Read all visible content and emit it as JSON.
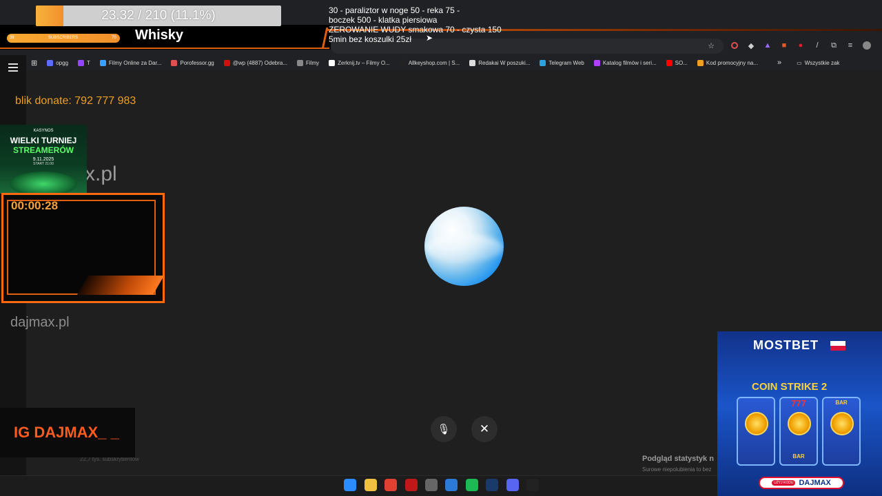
{
  "overlay": {
    "sub_goal_text": "23.32 / 210 (11.1%)",
    "sub_goal_progress": 0.111,
    "mini_left": "38",
    "mini_label": "SUBSCRIBERS",
    "mini_right": "70",
    "stream_title": "Whisky",
    "goals": [
      "30 - paraliztor w noge 50 - reka 75 -",
      " boczek 500 - klatka piersiowa",
      "ZEROWANIE WUDY smakowa 70 - czysta 150",
      "5min bez koszulki 25zł"
    ],
    "blik": "blik donate: 792 777 983",
    "kasyno_brand": "KASYNOS",
    "kasyno_title1": "WIELKI TURNIEJ",
    "kasyno_title2": "STREAMERÓW",
    "kasyno_date": "9.11.2025",
    "kasyno_start": "START 21:00",
    "ghost_domain": "x.pl",
    "timer": "00:00:28",
    "dajmax_url": "dajmax.pl",
    "ig": "IG DAJMAX_ _",
    "mostbet_brand": "MOSTBET",
    "mostbet_game": "COIN STRIKE 2",
    "mostbet_reel_text": "777",
    "mostbet_bar": "BAR",
    "mostbet_code_label": "UŻYJ KODU",
    "mostbet_code": "DAJMAX"
  },
  "bookmarks": [
    {
      "label": "opgg",
      "color": "#5b6cff"
    },
    {
      "label": "T",
      "color": "#9146ff"
    },
    {
      "label": "Filmy Online za Dar...",
      "color": "#3aa0ff"
    },
    {
      "label": "Porofessor.gg",
      "color": "#e05050"
    },
    {
      "label": "@wp (4887) Odebra...",
      "color": "#d01010"
    },
    {
      "label": "Filmy",
      "color": "#888888"
    },
    {
      "label": "Zerknij.tv – Filmy O...",
      "color": "#ffffff"
    },
    {
      "label": "Allkeyshop.com | S...",
      "color": "#222222"
    },
    {
      "label": "Redakai W poszuki...",
      "color": "#dddddd"
    },
    {
      "label": "Telegram Web",
      "color": "#2aa3e0"
    },
    {
      "label": "Katalog filmów i seri...",
      "color": "#b040ff"
    },
    {
      "label": "SO...",
      "color": "#ff0000"
    },
    {
      "label": "Kod promocyjny na...",
      "color": "#f0a020"
    }
  ],
  "bookmarks_more": "»",
  "bookmarks_all": "Wszystkie zak",
  "ghost": {
    "stats_title": "Podgląd statystyk n",
    "stats_sub": "Surowe niepolubienia to bez",
    "subs": "22,7 tys. subskrybentów"
  },
  "controls": {
    "mic_icon": "🎙",
    "close_icon": "✕"
  },
  "taskbar_apps": [
    {
      "name": "start",
      "color": "#2b8cff"
    },
    {
      "name": "files",
      "color": "#f0c040"
    },
    {
      "name": "chrome",
      "color": "#e04030"
    },
    {
      "name": "app-red",
      "color": "#c01818"
    },
    {
      "name": "app-circle",
      "color": "#666666"
    },
    {
      "name": "app-c",
      "color": "#2a7ad6"
    },
    {
      "name": "spotify",
      "color": "#1db954"
    },
    {
      "name": "steam",
      "color": "#1a3b6a"
    },
    {
      "name": "discord",
      "color": "#5865f2"
    },
    {
      "name": "logitech",
      "color": "#222222"
    }
  ]
}
